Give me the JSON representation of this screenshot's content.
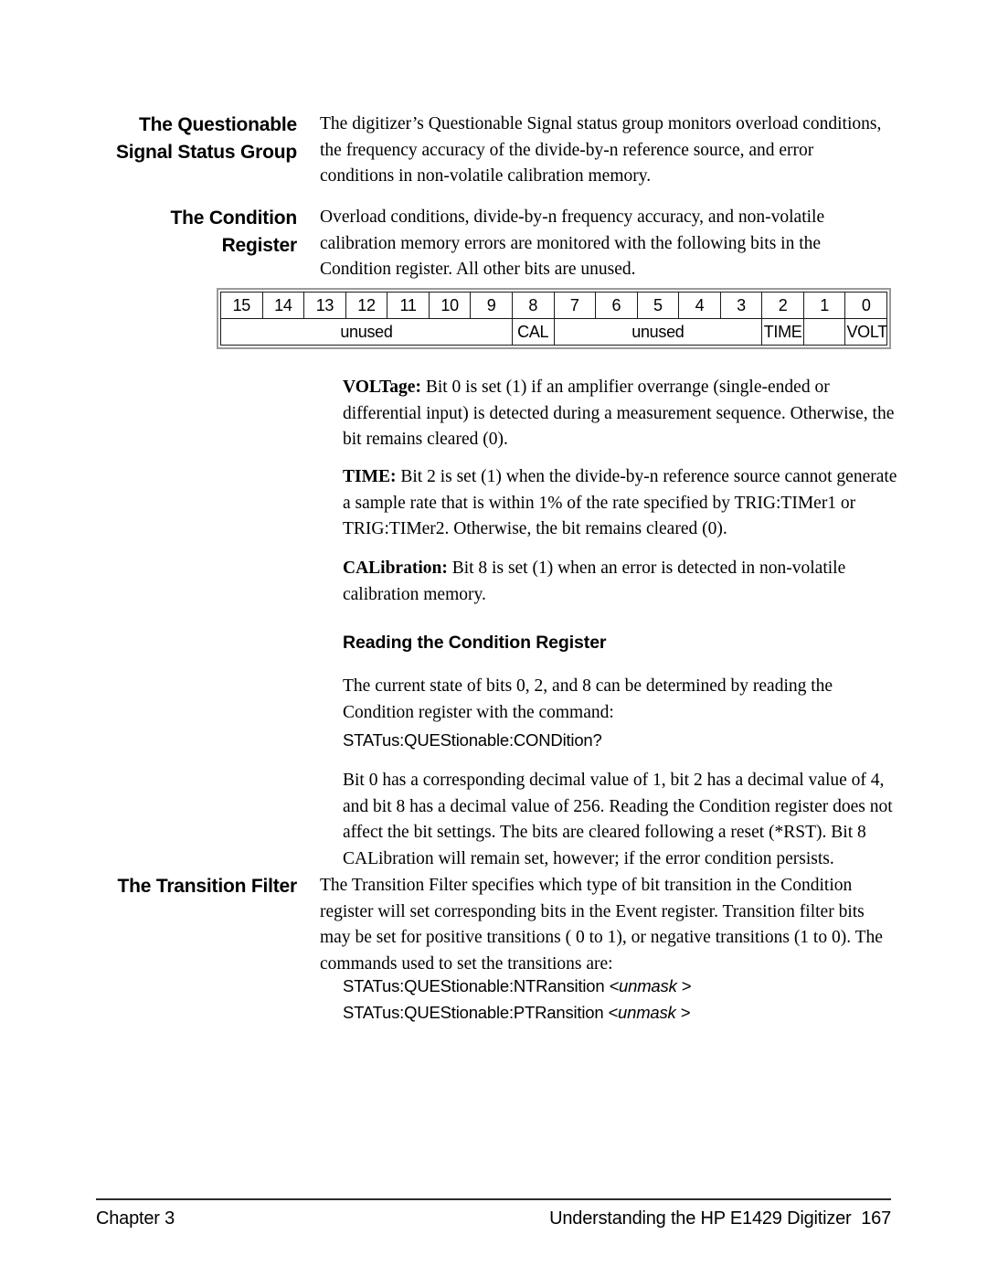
{
  "document": {
    "section_heading_line1": "The Questionable",
    "section_heading_line2": "Signal Status Group"
  },
  "section_intro": {
    "heading": "The Questionable Signal Status Group",
    "paragraph": "The digitizer’s Questionable Signal status group monitors overload conditions, the frequency accuracy of the divide-by-n  reference source, and error conditions in non-volatile calibration memory."
  },
  "condition_register": {
    "heading": "The Condition Register",
    "paragraph": "Overload conditions, divide-by-n frequency accuracy, and non-volatile calibration memory errors are monitored with the following bits in the Condition register. All other bits are unused."
  },
  "register_table": {
    "bits": [
      "15",
      "14",
      "13",
      "12",
      "11",
      "10",
      "9",
      "8",
      "7",
      "6",
      "5",
      "4",
      "3",
      "2",
      "1",
      "0"
    ],
    "names": [
      {
        "label": "unused",
        "span": 7
      },
      {
        "label": "CAL",
        "span": 1
      },
      {
        "label": "unused",
        "span": 5
      },
      {
        "label": "TIME",
        "span": 1
      },
      {
        "label": "",
        "span": 1
      },
      {
        "label": "VOLT",
        "span": 1
      }
    ]
  },
  "bit_definitions": {
    "volt": {
      "lead": "VOLTage:",
      "text": " Bit 0 is set (1) if an amplifier overrange (single-ended or differential input) is detected during a measurement sequence. Otherwise, the bit remains cleared (0)."
    },
    "time": {
      "lead": "TIME:",
      "text": " Bit 2 is set (1) when the divide-by-n reference source cannot generate a sample rate that is within 1% of the rate specified by TRIG:TIMer1 or TRIG:TIMer2. Otherwise, the bit remains cleared (0)."
    },
    "cal": {
      "lead": "CALibration:",
      "text": " Bit 8 is set (1) when an error is detected in non-volatile calibration memory."
    }
  },
  "reading_condition_register": {
    "subheading": "Reading the Condition Register",
    "paragraph1": "The current state of bits 0, 2, and 8 can be determined by reading the Condition register with the command:",
    "command": "STATus:QUEStionable:CONDition?",
    "paragraph2": "Bit 0 has a corresponding decimal value of 1, bit 2 has a decimal value of 4, and bit 8 has a decimal value of 256. Reading the Condition register does not affect the bit settings. The bits are cleared following a reset (*RST). Bit 8 CALibration will remain set, however; if the error condition persists."
  },
  "transition_filter": {
    "heading": "The Transition Filter",
    "paragraph": "The Transition Filter specifies which type of bit transition in the Condition register will set corresponding bits in the Event register. Transition filter bits may be set for positive transitions ( 0 to 1), or negative transitions (1 to 0). The commands used to set the transitions are:",
    "command_nt_prefix": "STATus:QUEStionable:NTRansition ",
    "command_nt_arg": "<unmask >",
    "command_pt_prefix": "STATus:QUEStionable:PTRansition ",
    "command_pt_arg": "<unmask >"
  },
  "footer": {
    "left": "Chapter 3",
    "right": "Understanding the HP E1429 Digitizer  167"
  }
}
